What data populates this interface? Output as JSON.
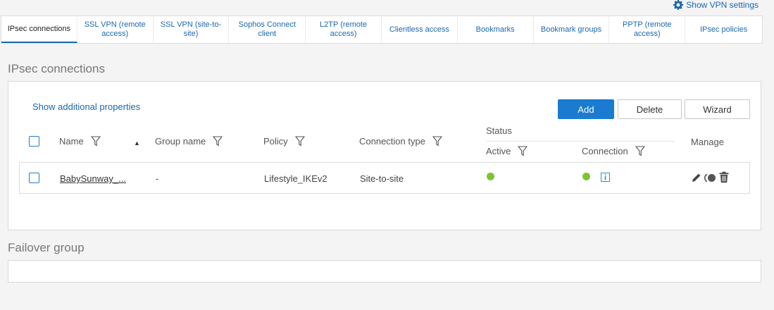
{
  "header": {
    "vpn_settings_label": "Show VPN settings"
  },
  "tabs": [
    {
      "label": "IPsec connections",
      "active": true
    },
    {
      "label": "SSL VPN (remote access)"
    },
    {
      "label": "SSL VPN (site-to-site)"
    },
    {
      "label": "Sophos Connect client"
    },
    {
      "label": "L2TP (remote access)"
    },
    {
      "label": "Clientless access"
    },
    {
      "label": "Bookmarks"
    },
    {
      "label": "Bookmark groups"
    },
    {
      "label": "PPTP (remote access)"
    },
    {
      "label": "IPsec policies"
    }
  ],
  "ipsec": {
    "title": "IPsec connections",
    "show_additional": "Show additional properties",
    "add_label": "Add",
    "delete_label": "Delete",
    "wizard_label": "Wizard",
    "columns": {
      "name": "Name",
      "group_name": "Group name",
      "policy": "Policy",
      "connection_type": "Connection type",
      "status": "Status",
      "active": "Active",
      "connection": "Connection",
      "manage": "Manage"
    },
    "rows": [
      {
        "name": "BabySunway_...",
        "group_name": "-",
        "policy": "Lifestyle_IKEv2",
        "connection_type": "Site-to-site"
      }
    ]
  },
  "failover": {
    "title": "Failover group"
  },
  "colors": {
    "accent": "#1a68b0",
    "status_green": "#7ac62f"
  }
}
